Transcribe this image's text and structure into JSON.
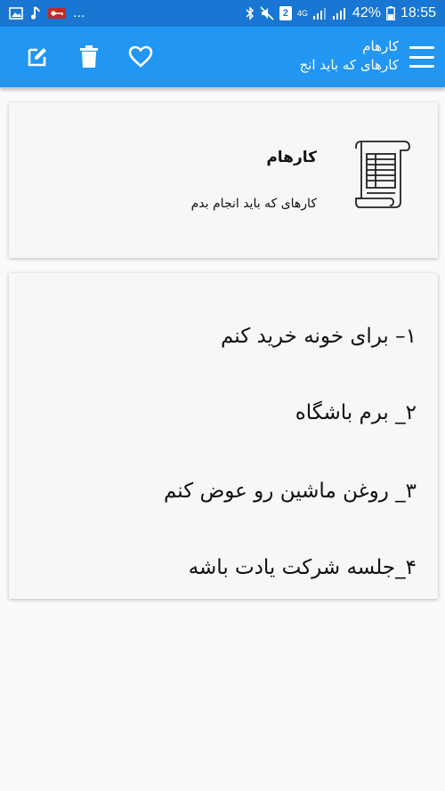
{
  "status_bar": {
    "dots": "...",
    "sim_badge": "2",
    "network": "4G",
    "battery": "42%",
    "time": "18:55"
  },
  "app_bar": {
    "title": "کارهام",
    "subtitle": "کارهای که باید انج"
  },
  "header": {
    "title": "کارهام",
    "description": "کارهای که باید انجام بدم"
  },
  "tasks": [
    "۱– برای خونه خرید کنم",
    "۲_ برم باشگاه",
    "۳_ روغن ماشین رو عوض کنم",
    "۴_جلسه شرکت یادت باشه"
  ],
  "colors": {
    "status_bar": "#1976d2",
    "app_bar": "#2196f3",
    "card": "#f7f7f7",
    "background": "#fafafa"
  }
}
